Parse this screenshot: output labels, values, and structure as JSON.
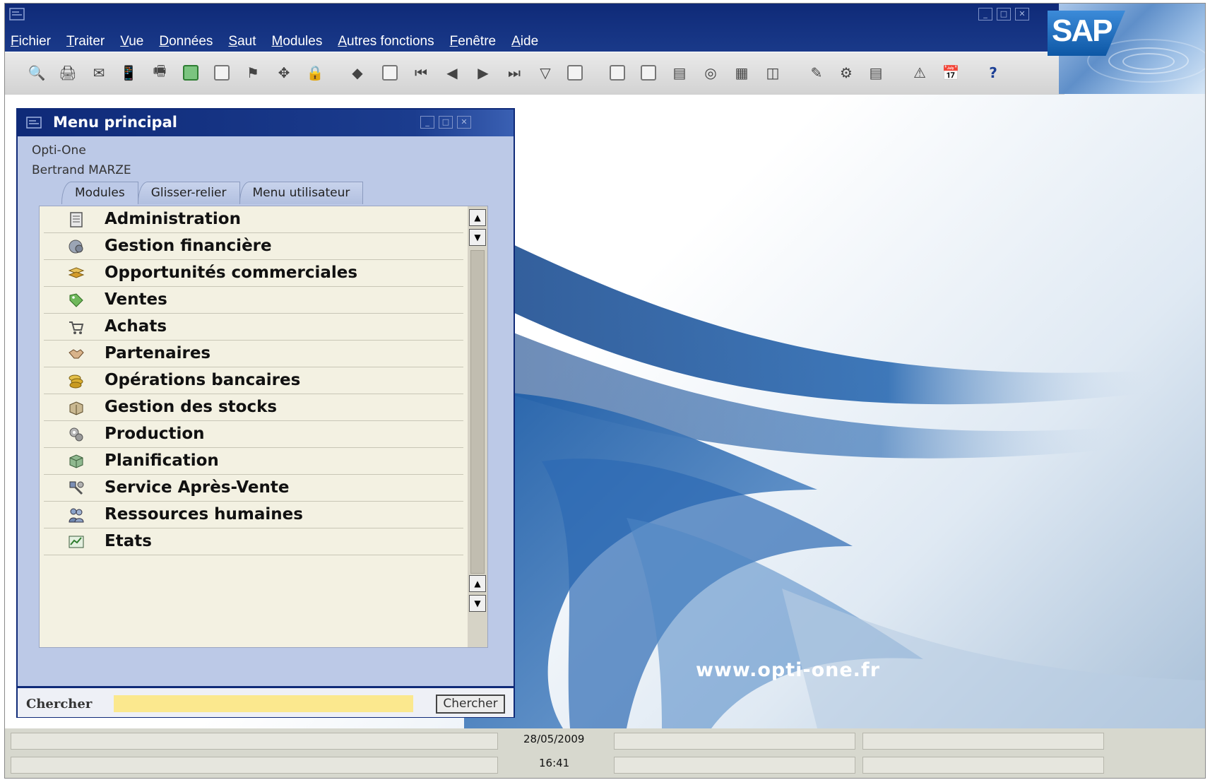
{
  "app": {
    "brand": "SAP",
    "window_controls": [
      "_",
      "□",
      "✕"
    ]
  },
  "menubar": {
    "items": [
      "Fichier",
      "Traiter",
      "Vue",
      "Données",
      "Saut",
      "Modules",
      "Autres fonctions",
      "Fenêtre",
      "Aide"
    ]
  },
  "toolbar": {
    "icons": [
      "preview-icon",
      "print-icon",
      "email-icon",
      "sms-icon",
      "fax-icon",
      "excel-icon",
      "word-icon",
      "pdf-icon",
      "move-icon",
      "lock-icon",
      "find-icon",
      "first-record-icon",
      "previous-page-icon",
      "previous-record-icon",
      "next-record-icon",
      "last-record-icon",
      "filter-icon",
      "sort-icon",
      "base-document-icon",
      "target-document-icon",
      "gross-profit-icon",
      "payment-means-icon",
      "volume-weight-icon",
      "layout-icon",
      "pen-icon",
      "settings-icon",
      "report-icon",
      "alert-icon",
      "calendar-icon",
      "help-icon"
    ]
  },
  "main_menu": {
    "title": "Menu principal",
    "company": "Opti-One",
    "user": "Bertrand MARZE",
    "tabs": [
      "Modules",
      "Glisser-relier",
      "Menu utilisateur"
    ],
    "active_tab": "Modules",
    "modules": [
      {
        "label": "Administration",
        "icon": "administration-icon"
      },
      {
        "label": "Gestion financière",
        "icon": "finance-icon"
      },
      {
        "label": "Opportunités commerciales",
        "icon": "opportunities-icon"
      },
      {
        "label": "Ventes",
        "icon": "sales-tag-icon"
      },
      {
        "label": "Achats",
        "icon": "shopping-cart-icon"
      },
      {
        "label": "Partenaires",
        "icon": "handshake-icon"
      },
      {
        "label": "Opérations bancaires",
        "icon": "coins-icon"
      },
      {
        "label": "Gestion des stocks",
        "icon": "inventory-box-icon"
      },
      {
        "label": "Production",
        "icon": "gears-icon"
      },
      {
        "label": "Planification",
        "icon": "planning-cube-icon"
      },
      {
        "label": "Service Après-Vente",
        "icon": "service-tools-icon"
      },
      {
        "label": "Ressources humaines",
        "icon": "people-icon"
      },
      {
        "label": "Etats",
        "icon": "reports-chart-icon"
      }
    ],
    "search": {
      "label": "Chercher",
      "value": "",
      "button_label": "Chercher"
    }
  },
  "background": {
    "url_text": "www.opti-one.fr"
  },
  "statusbar": {
    "date": "28/05/2009",
    "time": "16:41"
  },
  "colors": {
    "title_blue": "#0f2a78",
    "menu_bg": "#bcc9e7",
    "list_bg": "#f3f1e2",
    "search_yellow": "#fbe88e"
  }
}
